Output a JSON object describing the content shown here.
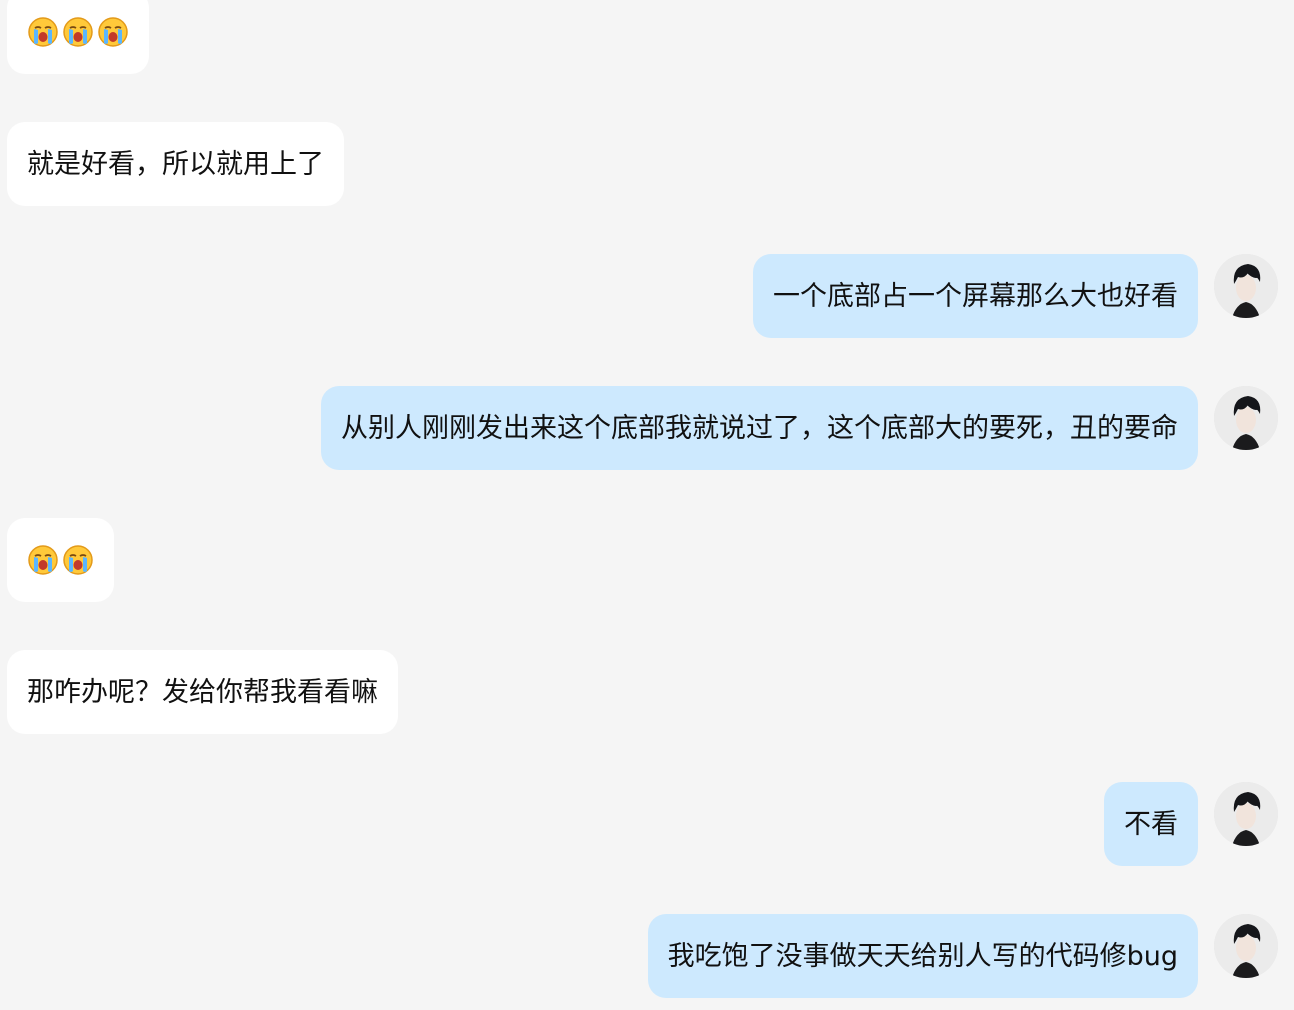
{
  "chat": {
    "messages": [
      {
        "side": "left",
        "emoji": [
          "loudly-crying-face-emoji",
          "loudly-crying-face-emoji",
          "loudly-crying-face-emoji"
        ],
        "text": ""
      },
      {
        "side": "left",
        "text": "就是好看，所以就用上了"
      },
      {
        "side": "right",
        "text": "一个底部占一个屏幕那么大也好看"
      },
      {
        "side": "right",
        "text": "从别人刚刚发出来这个底部我就说过了，这个底部大的要死，丑的要命"
      },
      {
        "side": "left",
        "emoji": [
          "loudly-crying-face-emoji",
          "loudly-crying-face-emoji"
        ],
        "text": ""
      },
      {
        "side": "left",
        "text": "那咋办呢？发给你帮我看看嘛"
      },
      {
        "side": "right",
        "text": "不看"
      },
      {
        "side": "right",
        "text": "我吃饱了没事做天天给别人写的代码修bug"
      }
    ],
    "avatar": "dark-haired-man-avatar",
    "colors": {
      "background": "#f5f5f5",
      "incoming_bubble": "#ffffff",
      "outgoing_bubble": "#cde9fe",
      "text": "#111111"
    }
  }
}
